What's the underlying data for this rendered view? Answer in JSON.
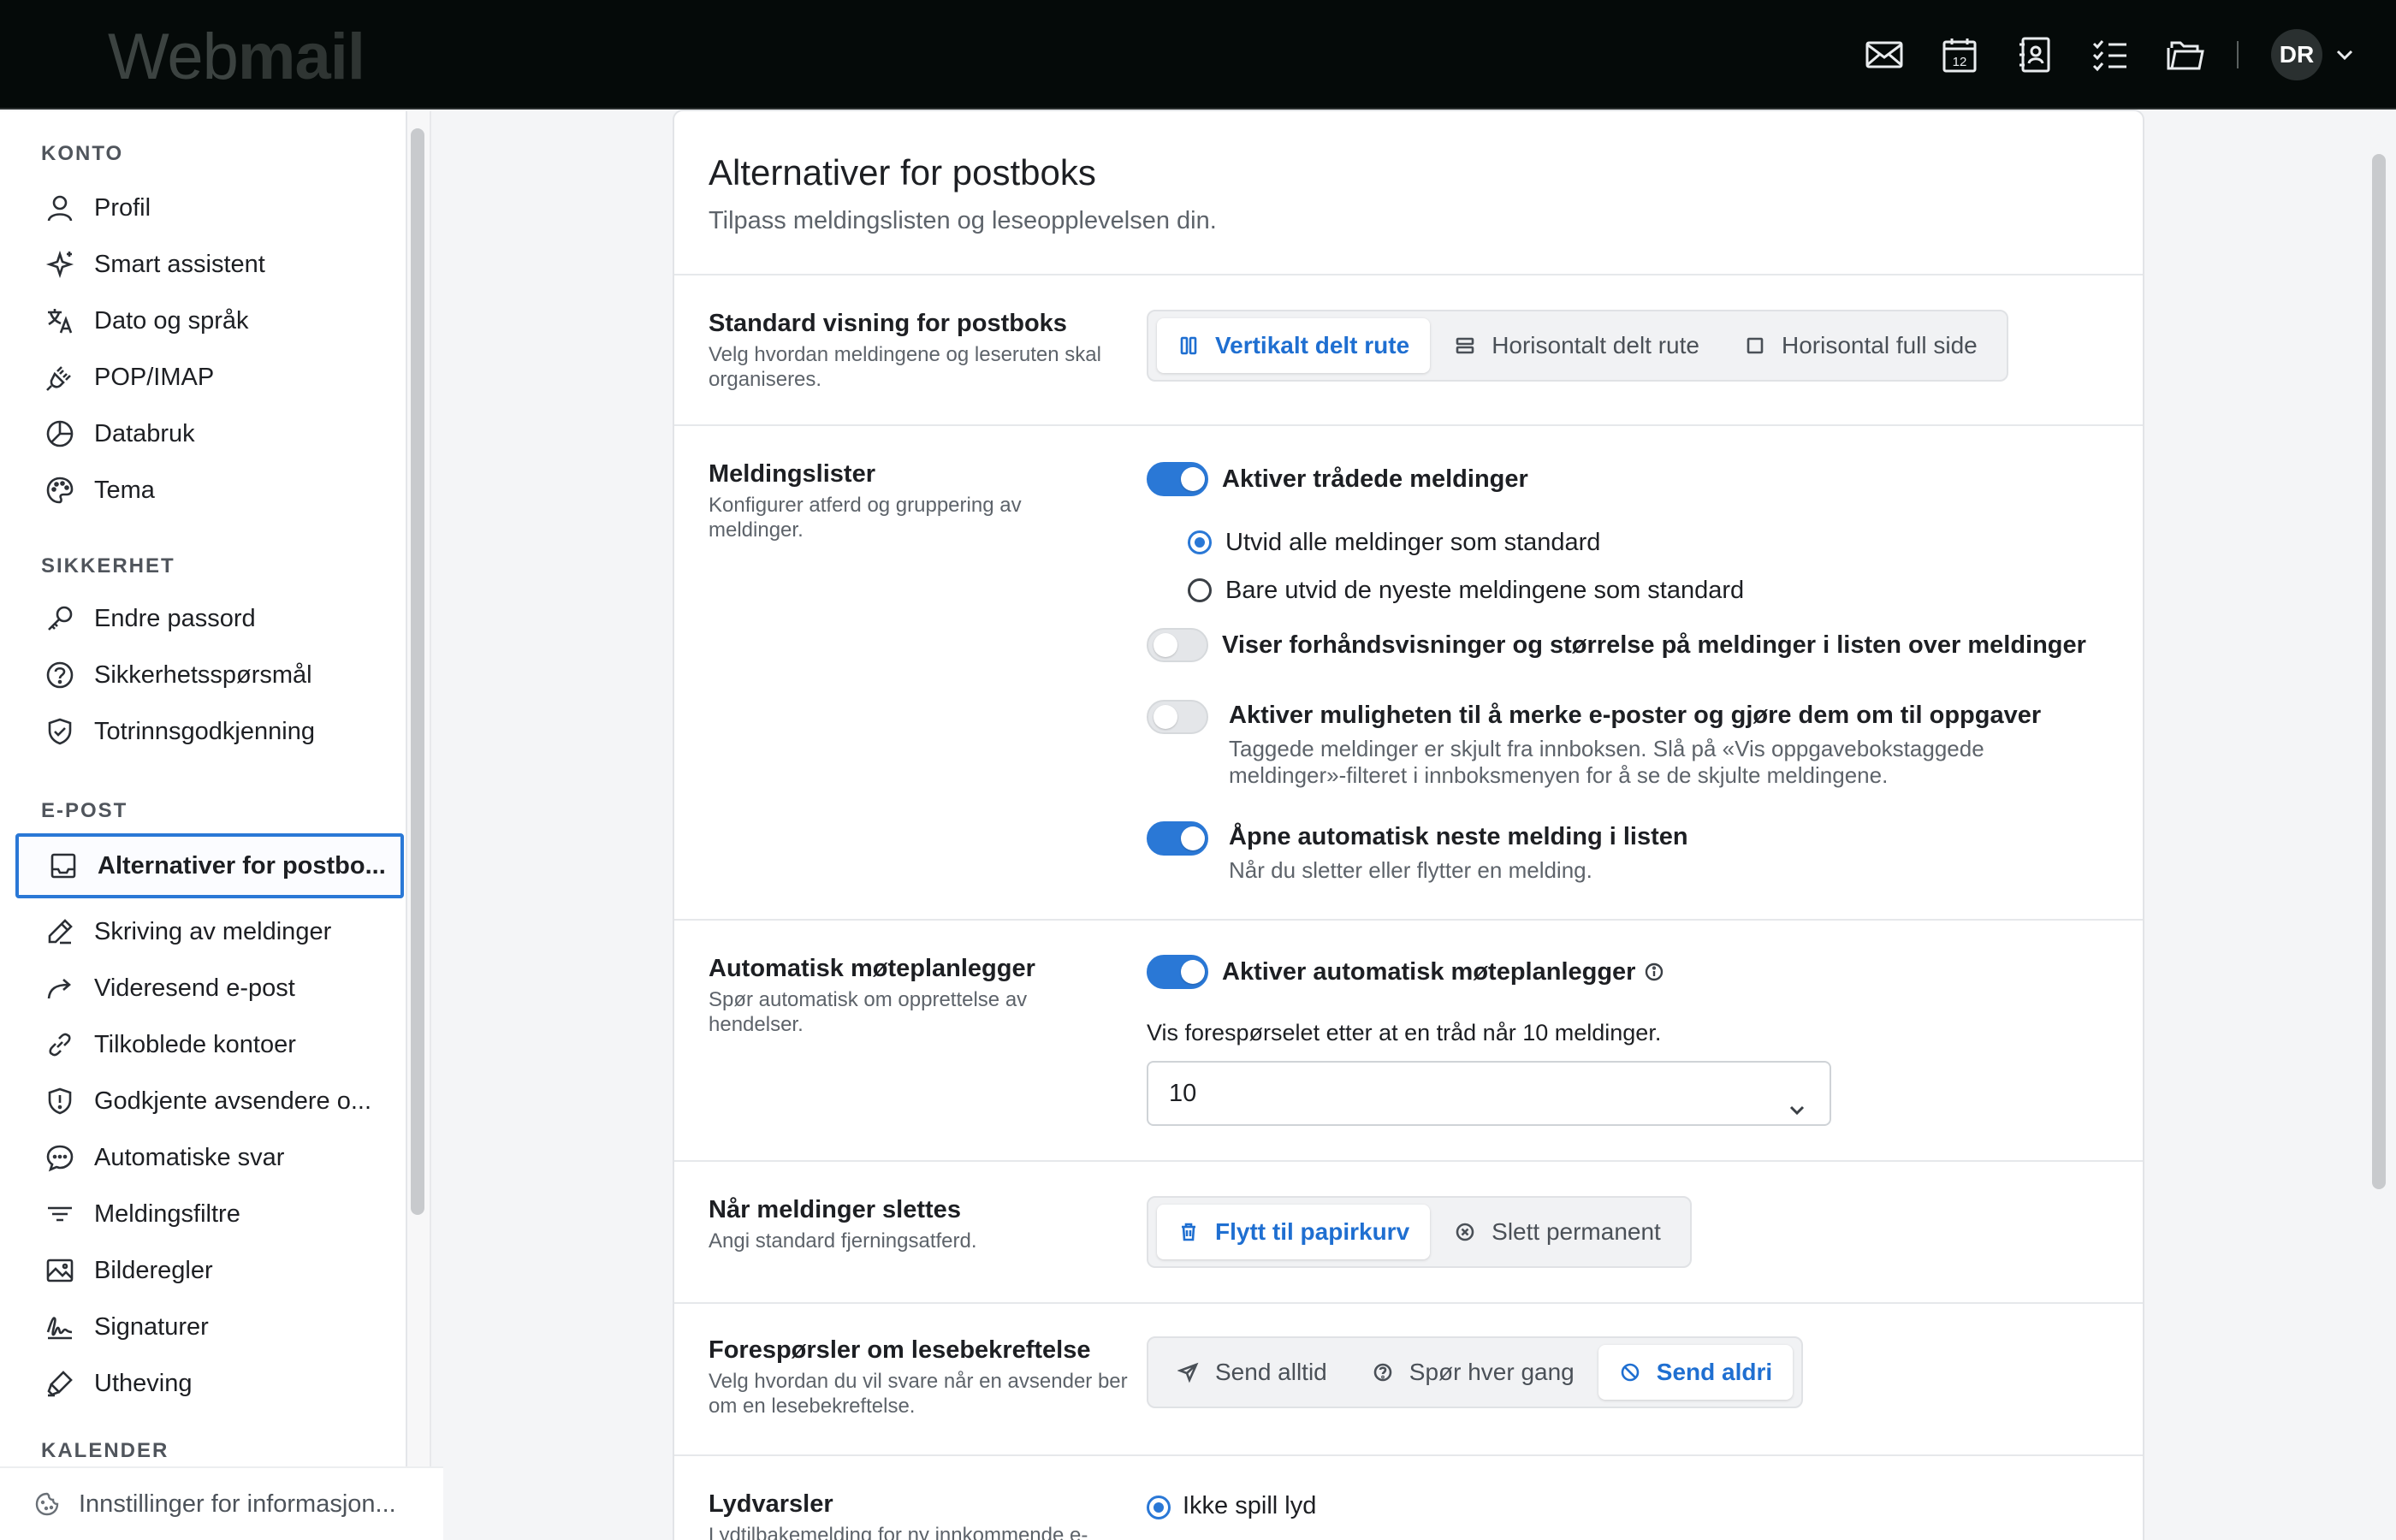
{
  "app": {
    "brand_light": "Web",
    "brand_bold": "mail",
    "avatar_initials": "DR"
  },
  "topbar_icons": [
    "mail-icon",
    "calendar-icon",
    "contacts-icon",
    "tasks-icon",
    "folder-icon"
  ],
  "calendar_icon_day": "12",
  "sidebar": {
    "sections": {
      "konto": "KONTO",
      "sikkerhet": "SIKKERHET",
      "epost": "E-POST",
      "kalender": "KALENDER"
    },
    "konto_items": [
      {
        "label": "Profil",
        "icon": "user-icon"
      },
      {
        "label": "Smart assistent",
        "icon": "sparkle-icon"
      },
      {
        "label": "Dato og språk",
        "icon": "translate-icon"
      },
      {
        "label": "POP/IMAP",
        "icon": "plug-icon"
      },
      {
        "label": "Databruk",
        "icon": "pie-chart-icon"
      },
      {
        "label": "Tema",
        "icon": "palette-icon"
      }
    ],
    "sikkerhet_items": [
      {
        "label": "Endre passord",
        "icon": "key-icon"
      },
      {
        "label": "Sikkerhetsspørsmål",
        "icon": "question-circle-icon"
      },
      {
        "label": "Totrinnsgodkjenning",
        "icon": "shield-check-icon"
      }
    ],
    "epost_items": [
      {
        "label": "Alternativer for postbo...",
        "icon": "inbox-icon",
        "active": true
      },
      {
        "label": "Skriving av meldinger",
        "icon": "pencil-icon"
      },
      {
        "label": "Videresend e-post",
        "icon": "forward-icon"
      },
      {
        "label": "Tilkoblede kontoer",
        "icon": "link-icon"
      },
      {
        "label": "Godkjente avsendere o...",
        "icon": "shield-alert-icon"
      },
      {
        "label": "Automatiske svar",
        "icon": "chat-icon"
      },
      {
        "label": "Meldingsfiltre",
        "icon": "filter-icon"
      },
      {
        "label": "Bilderegler",
        "icon": "image-icon"
      },
      {
        "label": "Signaturer",
        "icon": "signature-icon"
      },
      {
        "label": "Utheving",
        "icon": "highlighter-icon"
      }
    ],
    "footer_label": "Innstillinger for informasjon..."
  },
  "main": {
    "title": "Alternativer for postboks",
    "subtitle": "Tilpass meldingslisten og leseopplevelsen din.",
    "view": {
      "title": "Standard visning for postboks",
      "desc": "Velg hvordan meldingene og leseruten skal organiseres.",
      "options": [
        "Vertikalt delt rute",
        "Horisontalt delt rute",
        "Horisontal full side"
      ],
      "selected": "Vertikalt delt rute"
    },
    "lists": {
      "title": "Meldingslister",
      "desc": "Konfigurer atferd og gruppering av meldinger.",
      "threaded_label": "Aktiver trådede meldinger",
      "threaded_on": true,
      "radio_expand_all": "Utvid alle meldinger som standard",
      "radio_expand_newest": "Bare utvid de nyeste meldingene som standard",
      "preview_label": "Viser forhåndsvisninger og størrelse på meldinger i listen over meldinger",
      "preview_on": false,
      "tasks_label": "Aktiver muligheten til å merke e-poster og gjøre dem om til oppgaver",
      "tasks_help": "Taggede meldinger er skjult fra innboksen. Slå på «Vis oppgavebokstaggede meldinger»-filteret i innboksmenyen for å se de skjulte meldingene.",
      "tasks_on": false,
      "autoopen_label": "Åpne automatisk neste melding i listen",
      "autoopen_help": "Når du sletter eller flytter en melding.",
      "autoopen_on": true
    },
    "scheduler": {
      "title": "Automatisk møteplanlegger",
      "desc": "Spør automatisk om opprettelse av hendelser.",
      "toggle_label": "Aktiver automatisk møteplanlegger",
      "toggle_on": true,
      "threshold_label": "Vis forespørselet etter at en tråd når 10 meldinger.",
      "threshold_value": "10"
    },
    "delete": {
      "title": "Når meldinger slettes",
      "desc": "Angi standard fjerningsatferd.",
      "options": [
        "Flytt til papirkurv",
        "Slett permanent"
      ],
      "selected": "Flytt til papirkurv"
    },
    "receipts": {
      "title": "Forespørsler om lesebekreftelse",
      "desc": "Velg hvordan du vil svare når en avsender ber om en lesebekreftelse.",
      "options": [
        "Send alltid",
        "Spør hver gang",
        "Send aldri"
      ],
      "selected": "Send aldri"
    },
    "sounds": {
      "title": "Lydvarsler",
      "desc": "Lydtilbakemelding for ny innkommende e-",
      "option": "Ikke spill lyd"
    }
  }
}
